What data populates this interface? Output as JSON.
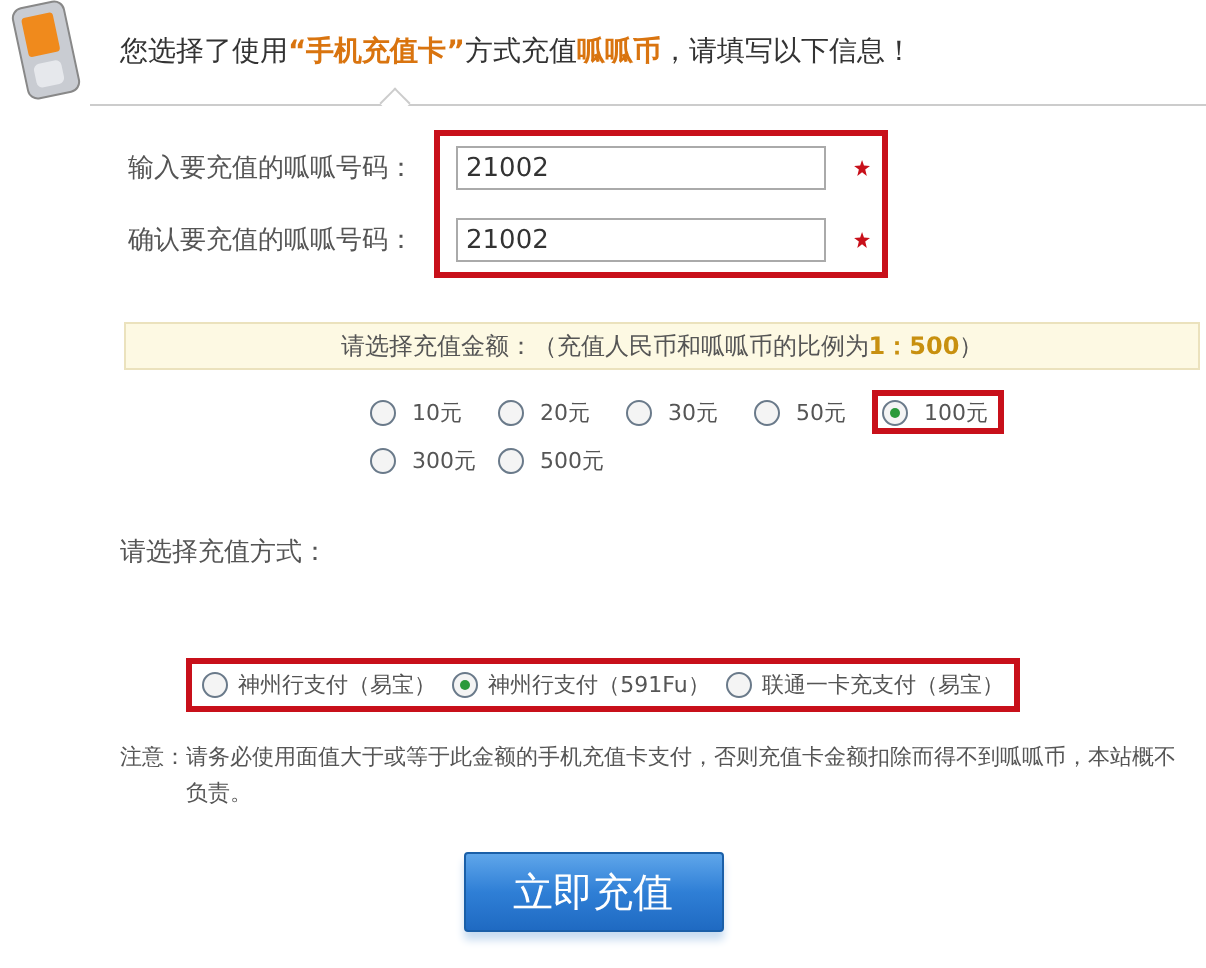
{
  "header": {
    "text": "您选择了使用**“手机充值卡”**方式充值**呱呱币**，请填写以下信息！"
  },
  "fields": [
    {
      "label": "输入要充值的呱呱号码：",
      "value": "21002",
      "required": true
    },
    {
      "label": "确认要充值的呱呱号码：",
      "value": "21002",
      "required": true
    }
  ],
  "amount_prompt": "请选择充值金额：（充值人民币和呱呱币的比例为**1：500**）",
  "amounts": [
    {
      "label": "10元",
      "selected": false
    },
    {
      "label": "20元",
      "selected": false
    },
    {
      "label": "30元",
      "selected": false
    },
    {
      "label": "50元",
      "selected": false
    },
    {
      "label": "100元",
      "selected": true
    },
    {
      "label": "300元",
      "selected": false
    },
    {
      "label": "500元",
      "selected": false
    }
  ],
  "method_label": "请选择充值方式：",
  "methods": [
    {
      "label": "神州行支付（易宝）",
      "selected": false
    },
    {
      "label": "神州行支付（591Fu）",
      "selected": true
    },
    {
      "label": "联通一卡充支付（易宝）",
      "selected": false
    }
  ],
  "note": {
    "label": "注意：",
    "text": "请务必使用面值大于或等于此金额的手机充值卡支付，否则充值卡金额扣除而得不到呱呱币，本站概不负责。"
  },
  "submit": "立即充值"
}
